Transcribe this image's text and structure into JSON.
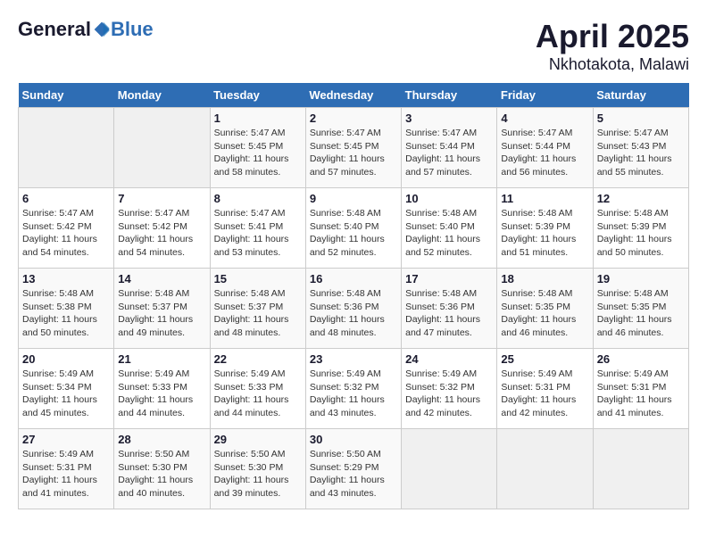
{
  "header": {
    "logo_general": "General",
    "logo_blue": "Blue",
    "month_year": "April 2025",
    "location": "Nkhotakota, Malawi"
  },
  "weekdays": [
    "Sunday",
    "Monday",
    "Tuesday",
    "Wednesday",
    "Thursday",
    "Friday",
    "Saturday"
  ],
  "weeks": [
    [
      {
        "day": "",
        "sunrise": "",
        "sunset": "",
        "daylight": ""
      },
      {
        "day": "",
        "sunrise": "",
        "sunset": "",
        "daylight": ""
      },
      {
        "day": "1",
        "sunrise": "Sunrise: 5:47 AM",
        "sunset": "Sunset: 5:45 PM",
        "daylight": "Daylight: 11 hours and 58 minutes."
      },
      {
        "day": "2",
        "sunrise": "Sunrise: 5:47 AM",
        "sunset": "Sunset: 5:45 PM",
        "daylight": "Daylight: 11 hours and 57 minutes."
      },
      {
        "day": "3",
        "sunrise": "Sunrise: 5:47 AM",
        "sunset": "Sunset: 5:44 PM",
        "daylight": "Daylight: 11 hours and 57 minutes."
      },
      {
        "day": "4",
        "sunrise": "Sunrise: 5:47 AM",
        "sunset": "Sunset: 5:44 PM",
        "daylight": "Daylight: 11 hours and 56 minutes."
      },
      {
        "day": "5",
        "sunrise": "Sunrise: 5:47 AM",
        "sunset": "Sunset: 5:43 PM",
        "daylight": "Daylight: 11 hours and 55 minutes."
      }
    ],
    [
      {
        "day": "6",
        "sunrise": "Sunrise: 5:47 AM",
        "sunset": "Sunset: 5:42 PM",
        "daylight": "Daylight: 11 hours and 54 minutes."
      },
      {
        "day": "7",
        "sunrise": "Sunrise: 5:47 AM",
        "sunset": "Sunset: 5:42 PM",
        "daylight": "Daylight: 11 hours and 54 minutes."
      },
      {
        "day": "8",
        "sunrise": "Sunrise: 5:47 AM",
        "sunset": "Sunset: 5:41 PM",
        "daylight": "Daylight: 11 hours and 53 minutes."
      },
      {
        "day": "9",
        "sunrise": "Sunrise: 5:48 AM",
        "sunset": "Sunset: 5:40 PM",
        "daylight": "Daylight: 11 hours and 52 minutes."
      },
      {
        "day": "10",
        "sunrise": "Sunrise: 5:48 AM",
        "sunset": "Sunset: 5:40 PM",
        "daylight": "Daylight: 11 hours and 52 minutes."
      },
      {
        "day": "11",
        "sunrise": "Sunrise: 5:48 AM",
        "sunset": "Sunset: 5:39 PM",
        "daylight": "Daylight: 11 hours and 51 minutes."
      },
      {
        "day": "12",
        "sunrise": "Sunrise: 5:48 AM",
        "sunset": "Sunset: 5:39 PM",
        "daylight": "Daylight: 11 hours and 50 minutes."
      }
    ],
    [
      {
        "day": "13",
        "sunrise": "Sunrise: 5:48 AM",
        "sunset": "Sunset: 5:38 PM",
        "daylight": "Daylight: 11 hours and 50 minutes."
      },
      {
        "day": "14",
        "sunrise": "Sunrise: 5:48 AM",
        "sunset": "Sunset: 5:37 PM",
        "daylight": "Daylight: 11 hours and 49 minutes."
      },
      {
        "day": "15",
        "sunrise": "Sunrise: 5:48 AM",
        "sunset": "Sunset: 5:37 PM",
        "daylight": "Daylight: 11 hours and 48 minutes."
      },
      {
        "day": "16",
        "sunrise": "Sunrise: 5:48 AM",
        "sunset": "Sunset: 5:36 PM",
        "daylight": "Daylight: 11 hours and 48 minutes."
      },
      {
        "day": "17",
        "sunrise": "Sunrise: 5:48 AM",
        "sunset": "Sunset: 5:36 PM",
        "daylight": "Daylight: 11 hours and 47 minutes."
      },
      {
        "day": "18",
        "sunrise": "Sunrise: 5:48 AM",
        "sunset": "Sunset: 5:35 PM",
        "daylight": "Daylight: 11 hours and 46 minutes."
      },
      {
        "day": "19",
        "sunrise": "Sunrise: 5:48 AM",
        "sunset": "Sunset: 5:35 PM",
        "daylight": "Daylight: 11 hours and 46 minutes."
      }
    ],
    [
      {
        "day": "20",
        "sunrise": "Sunrise: 5:49 AM",
        "sunset": "Sunset: 5:34 PM",
        "daylight": "Daylight: 11 hours and 45 minutes."
      },
      {
        "day": "21",
        "sunrise": "Sunrise: 5:49 AM",
        "sunset": "Sunset: 5:33 PM",
        "daylight": "Daylight: 11 hours and 44 minutes."
      },
      {
        "day": "22",
        "sunrise": "Sunrise: 5:49 AM",
        "sunset": "Sunset: 5:33 PM",
        "daylight": "Daylight: 11 hours and 44 minutes."
      },
      {
        "day": "23",
        "sunrise": "Sunrise: 5:49 AM",
        "sunset": "Sunset: 5:32 PM",
        "daylight": "Daylight: 11 hours and 43 minutes."
      },
      {
        "day": "24",
        "sunrise": "Sunrise: 5:49 AM",
        "sunset": "Sunset: 5:32 PM",
        "daylight": "Daylight: 11 hours and 42 minutes."
      },
      {
        "day": "25",
        "sunrise": "Sunrise: 5:49 AM",
        "sunset": "Sunset: 5:31 PM",
        "daylight": "Daylight: 11 hours and 42 minutes."
      },
      {
        "day": "26",
        "sunrise": "Sunrise: 5:49 AM",
        "sunset": "Sunset: 5:31 PM",
        "daylight": "Daylight: 11 hours and 41 minutes."
      }
    ],
    [
      {
        "day": "27",
        "sunrise": "Sunrise: 5:49 AM",
        "sunset": "Sunset: 5:31 PM",
        "daylight": "Daylight: 11 hours and 41 minutes."
      },
      {
        "day": "28",
        "sunrise": "Sunrise: 5:50 AM",
        "sunset": "Sunset: 5:30 PM",
        "daylight": "Daylight: 11 hours and 40 minutes."
      },
      {
        "day": "29",
        "sunrise": "Sunrise: 5:50 AM",
        "sunset": "Sunset: 5:30 PM",
        "daylight": "Daylight: 11 hours and 39 minutes."
      },
      {
        "day": "30",
        "sunrise": "Sunrise: 5:50 AM",
        "sunset": "Sunset: 5:29 PM",
        "daylight": "Daylight: 11 hours and 43 minutes."
      },
      {
        "day": "",
        "sunrise": "",
        "sunset": "",
        "daylight": ""
      },
      {
        "day": "",
        "sunrise": "",
        "sunset": "",
        "daylight": ""
      },
      {
        "day": "",
        "sunrise": "",
        "sunset": "",
        "daylight": ""
      }
    ]
  ]
}
